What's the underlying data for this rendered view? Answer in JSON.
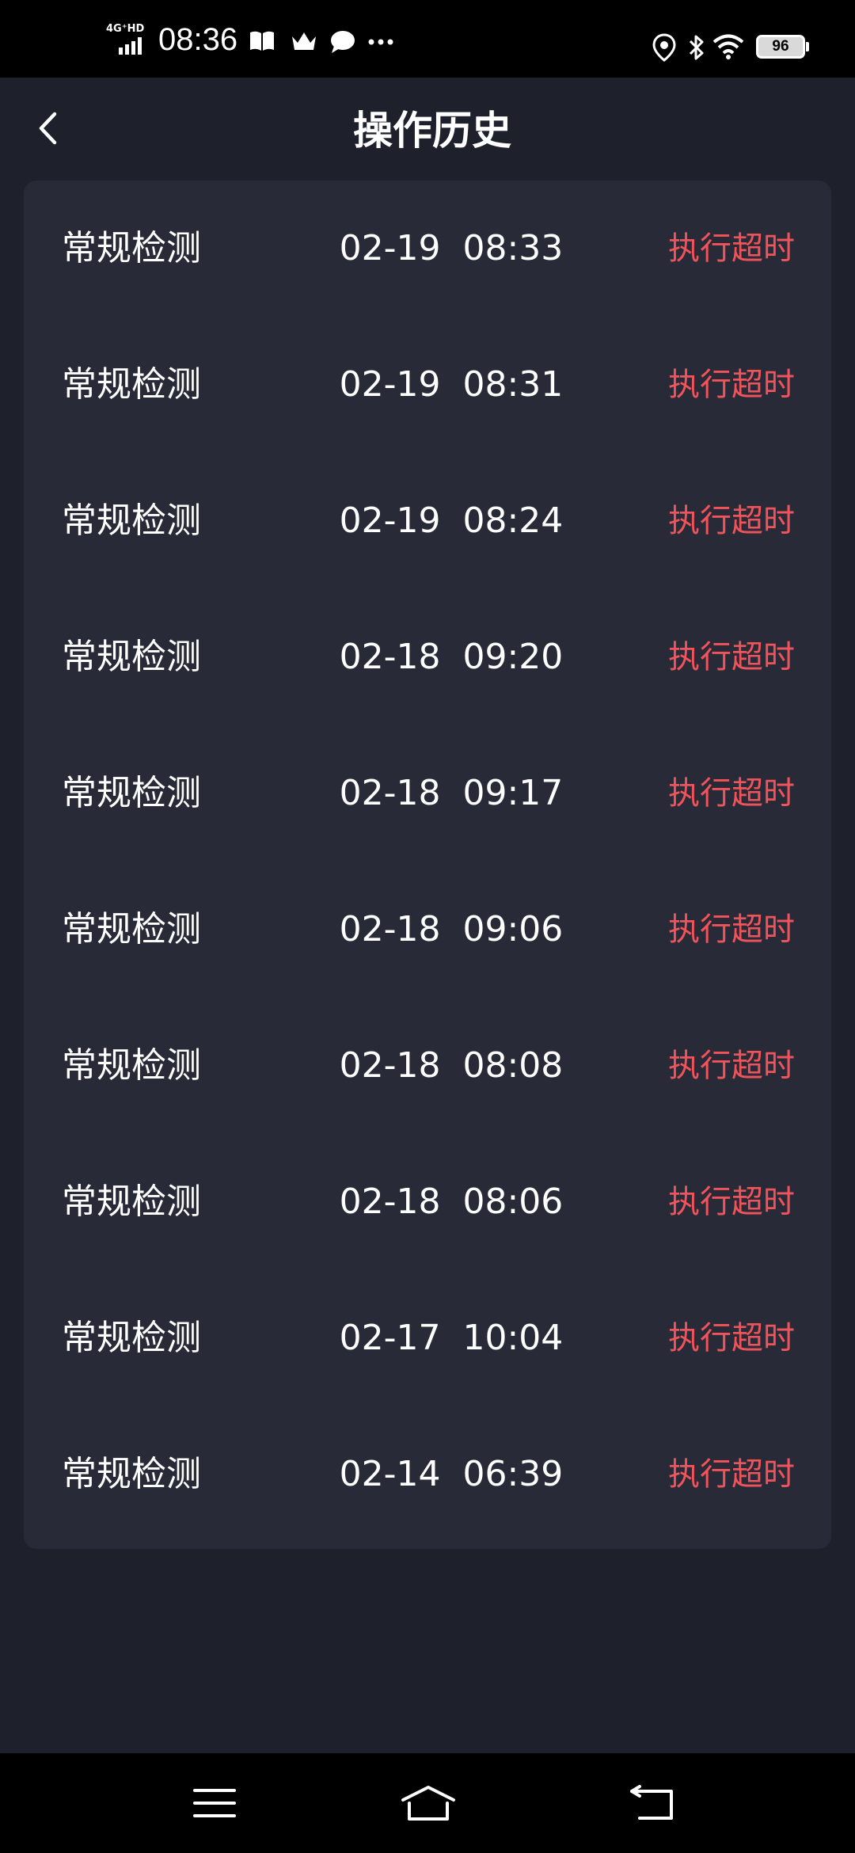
{
  "status_bar": {
    "network": "4G⁺HD",
    "time": "08:36",
    "icons": [
      "book-icon",
      "crown-icon",
      "chat-bubble-icon",
      "more-dots-icon",
      "location-icon",
      "bluetooth-icon",
      "wifi-icon"
    ],
    "battery": "96"
  },
  "header": {
    "title": "操作历史",
    "back_icon": "chevron-left-icon"
  },
  "history": [
    {
      "name": "常规检测",
      "time": "02-19  08:33",
      "status": "执行超时"
    },
    {
      "name": "常规检测",
      "time": "02-19  08:31",
      "status": "执行超时"
    },
    {
      "name": "常规检测",
      "time": "02-19  08:24",
      "status": "执行超时"
    },
    {
      "name": "常规检测",
      "time": "02-18  09:20",
      "status": "执行超时"
    },
    {
      "name": "常规检测",
      "time": "02-18  09:17",
      "status": "执行超时"
    },
    {
      "name": "常规检测",
      "time": "02-18  09:06",
      "status": "执行超时"
    },
    {
      "name": "常规检测",
      "time": "02-18  08:08",
      "status": "执行超时"
    },
    {
      "name": "常规检测",
      "time": "02-18  08:06",
      "status": "执行超时"
    },
    {
      "name": "常规检测",
      "time": "02-17  10:04",
      "status": "执行超时"
    },
    {
      "name": "常规检测",
      "time": "02-14  06:39",
      "status": "执行超时"
    }
  ],
  "colors": {
    "background": "#1e202b",
    "card": "#282a38",
    "status_red": "#f0545a",
    "text": "#ffffff"
  },
  "nav_bar": {
    "icons": [
      "menu-icon",
      "home-icon",
      "back-icon"
    ]
  }
}
